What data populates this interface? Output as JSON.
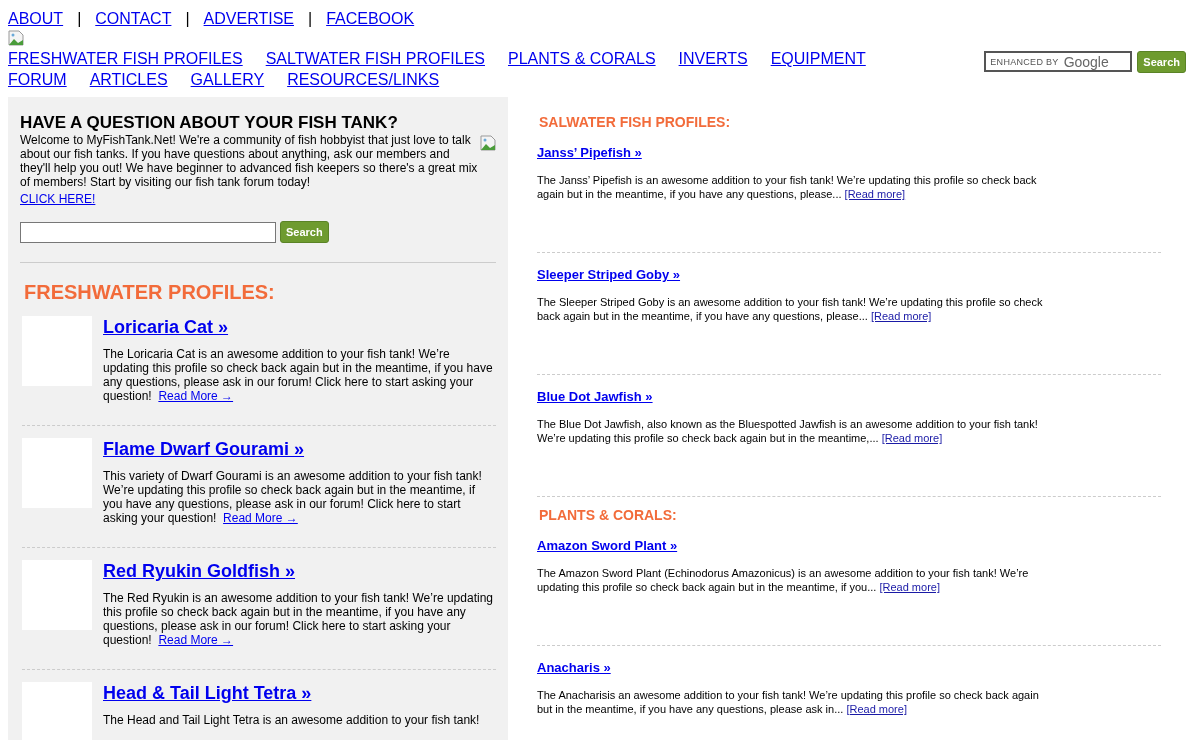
{
  "top_links": [
    {
      "label": "ABOUT"
    },
    {
      "label": "CONTACT"
    },
    {
      "label": "ADVERTISE"
    },
    {
      "label": "FACEBOOK"
    }
  ],
  "top_link_separators": [
    "|",
    "|",
    "|"
  ],
  "nav_rows": [
    [
      "FRESHWATER FISH PROFILES",
      "SALTWATER FISH PROFILES",
      "PLANTS & CORALS",
      "INVERTS",
      "EQUIPMENT"
    ],
    [
      "FORUM",
      "ARTICLES",
      "GALLERY",
      "RESOURCES/LINKS"
    ]
  ],
  "site_search": {
    "hint_prefix": "ENHANCED BY",
    "hint_brand": "Google",
    "button": "Search"
  },
  "question_box": {
    "title": "HAVE A QUESTION ABOUT YOUR FISH TANK?",
    "text": "Welcome to MyFishTank.Net! We're a community of fish hobbyist that just love to talk about our fish tanks. If you have questions about anything, ask our members and they'll help you out! We have beginner to advanced fish keepers so there's a great mix of members! Start by visiting our fish tank forum today!",
    "link": "CLICK HERE!",
    "button": "Search"
  },
  "freshwater": {
    "heading": "FRESHWATER PROFILES:",
    "items": [
      {
        "title": "Loricaria Cat »",
        "text": "The Loricaria Cat is an awesome addition to your fish tank! We’re updating this profile so check back again but in the meantime, if you have any questions, please ask in our forum! Click here to start asking your question!",
        "link": "Read More →"
      },
      {
        "title": "Flame Dwarf Gourami »",
        "text": "This variety of Dwarf Gourami is an awesome addition to your fish tank! We’re updating this profile so check back again but in the meantime, if you have any questions, please ask in our forum! Click here to start asking your question!",
        "link": "Read More →"
      },
      {
        "title": "Red Ryukin Goldfish »",
        "text": "The Red Ryukin is an awesome addition to your fish tank! We’re updating this profile so check back again but in the meantime, if you have any questions, please ask in our forum! Click here to start asking your question!",
        "link": "Read More →"
      },
      {
        "title": "Head & Tail Light Tetra »",
        "text": "The Head and Tail Light Tetra is an awesome addition to your fish tank!"
      }
    ]
  },
  "right_sections": [
    {
      "heading": "SALWATER FISH PROFILES:",
      "items": [
        {
          "title": "Janss’ Pipefish »",
          "text": "The Janss’ Pipefish is an awesome addition to your fish tank! We’re updating this profile so check back again but in the meantime, if you have any questions, please...",
          "link": "[Read more]"
        },
        {
          "title": "Sleeper Striped Goby »",
          "text": "The Sleeper Striped Goby is an awesome addition to your fish tank! We’re updating this profile so check back again but in the meantime, if you have any questions, please...",
          "link": "[Read more]"
        },
        {
          "title": "Blue Dot Jawfish »",
          "text": "The Blue Dot Jawfish, also known as the Bluespotted Jawfish is an awesome addition to your fish tank! We’re updating this profile so check back again but in the meantime,...",
          "link": "[Read more]"
        }
      ]
    },
    {
      "heading": "PLANTS & CORALS:",
      "items": [
        {
          "title": "Amazon Sword Plant »",
          "text": "The Amazon Sword Plant (Echinodorus Amazonicus) is an awesome addition to your fish tank! We’re updating this profile so check back again but in the meantime, if you...",
          "link": "[Read more]"
        },
        {
          "title": "Anacharis »",
          "text": "The Anacharisis an awesome addition to your fish tank! We’re updating this profile so check back again but in the meantime, if you have any questions, please ask in...",
          "link": "[Read more]"
        }
      ]
    }
  ]
}
